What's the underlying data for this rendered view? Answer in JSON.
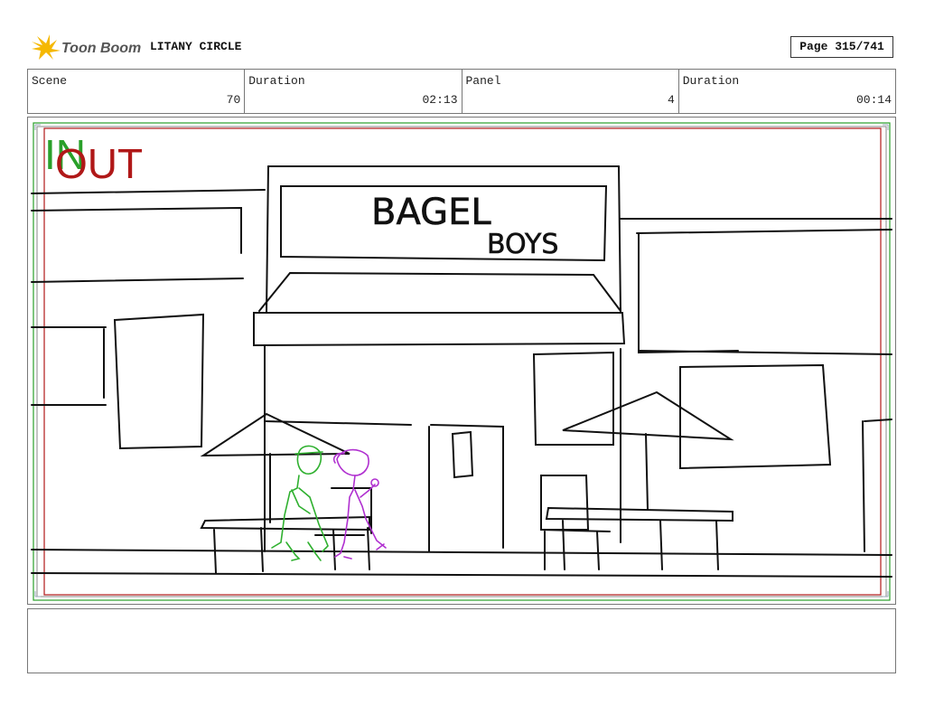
{
  "header": {
    "logo_text": "Toon Boom",
    "project_title": "LITANY CIRCLE",
    "page_label": "Page 315/741"
  },
  "info": {
    "scene_label": "Scene",
    "scene_value": "70",
    "duration_label": "Duration",
    "duration_value": "02:13",
    "panel_label": "Panel",
    "panel_value": "4",
    "panel_duration_label": "Duration",
    "panel_duration_value": "00:14"
  },
  "frame": {
    "in_label": "IN",
    "out_label": "OUT",
    "sign_line1": "BAGEL",
    "sign_line2": "BOYS",
    "in_color": "#2aa02a",
    "out_color": "#b01818"
  },
  "notes": {
    "text": ""
  }
}
